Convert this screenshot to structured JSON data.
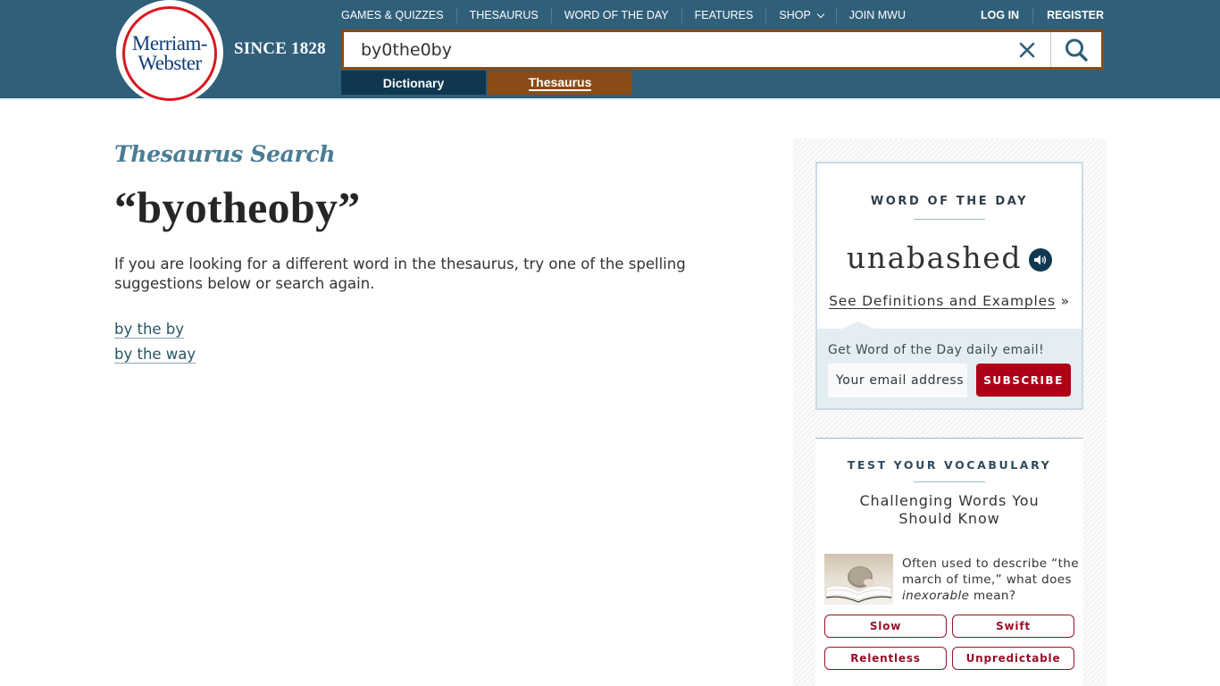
{
  "header": {
    "logo": {
      "line1": "Merriam-",
      "line2": "Webster"
    },
    "since": "SINCE 1828",
    "nav": [
      {
        "label": "GAMES & QUIZZES"
      },
      {
        "label": "THESAURUS"
      },
      {
        "label": "WORD OF THE DAY"
      },
      {
        "label": "FEATURES"
      },
      {
        "label": "SHOP",
        "icon": "chevron-down-icon"
      },
      {
        "label": "JOIN MWU"
      }
    ],
    "auth": {
      "login": "LOG IN",
      "register": "REGISTER"
    },
    "search": {
      "value": "by0the0by",
      "clear_icon": "close-icon",
      "search_icon": "search-icon"
    },
    "tabs": {
      "dictionary": "Dictionary",
      "thesaurus": "Thesaurus",
      "active": "thesaurus"
    },
    "colors": {
      "bar": "#305f7a",
      "accent": "#8a4b16",
      "dictionary_tab": "#0f3850"
    }
  },
  "main": {
    "section_title": "Thesaurus Search",
    "query": "“byotheoby”",
    "description": "If you are looking for a different word in the thesaurus, try one of the spelling suggestions below or search again.",
    "suggestions": [
      "by the by",
      "by the way"
    ]
  },
  "sidebar": {
    "wotd": {
      "heading": "WORD OF THE DAY",
      "word": "unabashed",
      "audio_icon": "speaker-icon",
      "link": "See Definitions and Examples",
      "link_suffix": "»",
      "email_label": "Get Word of the Day daily email!",
      "email_placeholder": "Your email address",
      "subscribe": "SUBSCRIBE"
    },
    "vocab": {
      "heading": "TEST YOUR VOCABULARY",
      "title": "Challenging Words You Should Know",
      "question_pre": "Often used to describe “the march of time,” what does ",
      "question_em": "inexorable",
      "question_post": " mean?",
      "image": "hedgehog-on-book",
      "answers": [
        "Slow",
        "Swift",
        "Relentless",
        "Unpredictable"
      ]
    }
  }
}
